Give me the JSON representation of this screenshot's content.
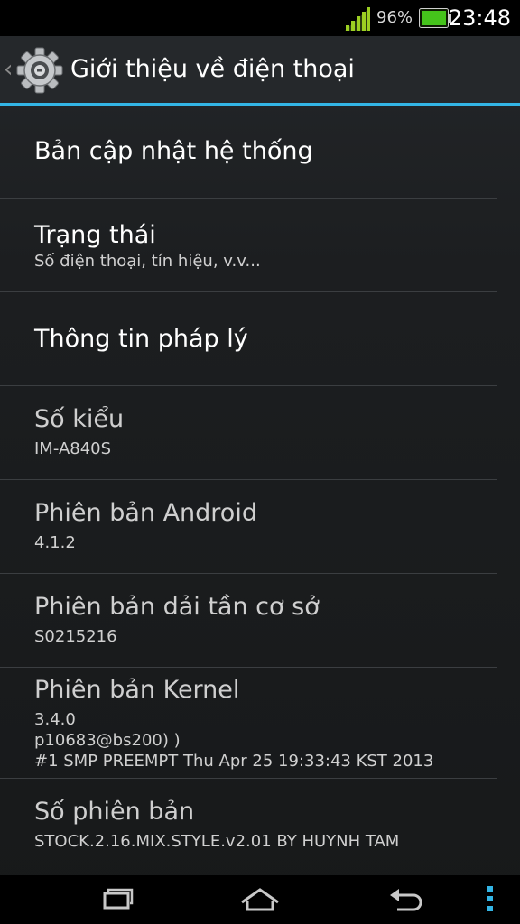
{
  "status_bar": {
    "signal_icon": "signal-strength-icon",
    "battery_percent": "96%",
    "battery_icon": "battery-charging-icon",
    "time": "23:48",
    "accent_color": "#9ccf22"
  },
  "action_bar": {
    "back_icon": "chevron-left-icon",
    "app_icon": "settings-gear-icon",
    "title": "Giới thiệu về điện thoại",
    "underline_color": "#33b5e5"
  },
  "items": [
    {
      "title": "Bản cập nhật hệ thống",
      "summary": ""
    },
    {
      "title": "Trạng thái",
      "summary": "Số điện thoại, tín hiệu, v.v..."
    },
    {
      "title": "Thông tin pháp lý",
      "summary": ""
    },
    {
      "title": "Số kiểu",
      "summary": "IM-A840S"
    },
    {
      "title": "Phiên bản Android",
      "summary": "4.1.2"
    },
    {
      "title": "Phiên bản dải tần cơ sở",
      "summary": "S0215216"
    },
    {
      "title": "Phiên bản Kernel",
      "summary_lines": [
        "3.4.0",
        "p10683@bs200) )",
        "#1 SMP PREEMPT Thu Apr 25 19:33:43 KST 2013"
      ]
    },
    {
      "title": "Số phiên bản",
      "summary": "STOCK.2.16.MIX.STYLE.v2.01 BY HUYNH TAM"
    }
  ],
  "nav_bar": {
    "recent_icon": "recent-apps-icon",
    "home_icon": "home-icon",
    "back_icon": "back-arrow-icon",
    "menu_icon": "overflow-menu-icon",
    "menu_color": "#33b5e5"
  }
}
